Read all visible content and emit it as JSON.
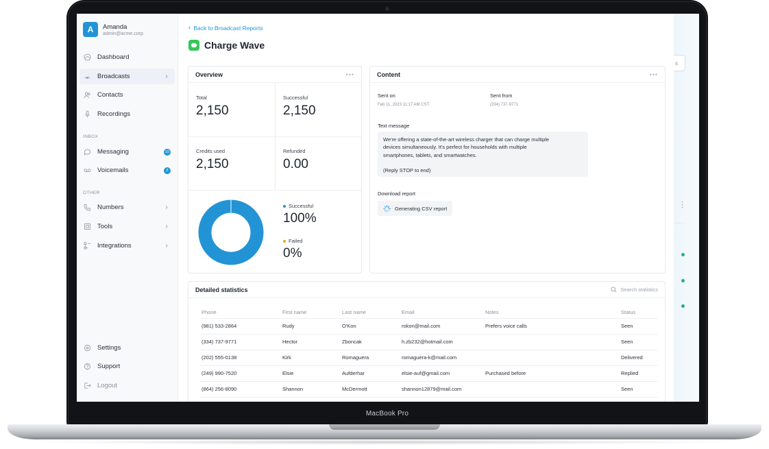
{
  "device": {
    "label": "MacBook Pro"
  },
  "sidebar": {
    "profile": {
      "initial": "A",
      "name": "Amanda",
      "email": "admin@acme.corp"
    },
    "items": [
      {
        "label": "Dashboard",
        "icon": "dashboard-icon"
      },
      {
        "label": "Broadcasts",
        "icon": "broadcast-icon",
        "active": true
      },
      {
        "label": "Contacts",
        "icon": "contacts-icon"
      },
      {
        "label": "Recordings",
        "icon": "microphone-icon"
      }
    ],
    "inbox_title": "INBOX",
    "inbox": [
      {
        "label": "Messaging",
        "icon": "chat-icon",
        "count": "10"
      },
      {
        "label": "Voicemails",
        "icon": "voicemail-icon",
        "count": "2"
      }
    ],
    "other_title": "OTHER",
    "other": [
      {
        "label": "Numbers",
        "icon": "phone-icon"
      },
      {
        "label": "Tools",
        "icon": "tools-icon"
      },
      {
        "label": "Integrations",
        "icon": "integrations-icon"
      }
    ],
    "footer": [
      {
        "label": "Settings",
        "icon": "gear-icon"
      },
      {
        "label": "Support",
        "icon": "help-icon"
      },
      {
        "label": "Logout",
        "icon": "logout-icon"
      }
    ]
  },
  "header": {
    "back_label": "Back to Broadcast Reports",
    "title": "Charge Wave",
    "title_icon_color": "#34c759"
  },
  "overview": {
    "title": "Overview",
    "total_label": "Total",
    "total_value": "2,150",
    "successful_label": "Successful",
    "successful_value": "2,150",
    "credits_label": "Credits used",
    "credits_value": "2,150",
    "refunded_label": "Refunded",
    "refunded_value": "0.00",
    "donut": {
      "successful_label": "Successful",
      "successful_pct": "100%",
      "successful_fraction": 1.0,
      "successful_color": "#2294d6",
      "failed_label": "Failed",
      "failed_pct": "0%",
      "failed_color": "#f0a020"
    }
  },
  "content": {
    "title": "Content",
    "sent_on_label": "Sent on",
    "sent_on_value": "Feb 11, 2023 11:17 AM CST",
    "sent_from_label": "Sent from",
    "sent_from_value": "(334) 737-9771",
    "text_label": "Text message",
    "message_lines": [
      "We're offering a state-of-the-art wireless charger that can charge multiple",
      "devices simultaneously. It's perfect for households with multiple",
      "smartphones, tablets, and smartwatches."
    ],
    "message_footer": "(Reply STOP to end)",
    "download_label": "Download report",
    "csv_label": "Generating CSV report"
  },
  "stats": {
    "title": "Detailed statistics",
    "search_placeholder": "Search statistics",
    "columns": [
      "Phone",
      "First name",
      "Last name",
      "Email",
      "Notes",
      "Status"
    ],
    "rows": [
      [
        "(981) 533-2864",
        "Rudy",
        "O'Kon",
        "rokon@mail.com",
        "Prefers voice calls",
        "Seen"
      ],
      [
        "(334) 737-9771",
        "Hector",
        "Zboncak",
        "h.zb232@hotmail.com",
        "",
        "Seen"
      ],
      [
        "(202) 555-0138",
        "Kirk",
        "Romaguera",
        "romaguera-k@mail.com",
        "",
        "Delivered"
      ],
      [
        "(249) 990-7520",
        "Elsie",
        "Aufderhar",
        "elsie-auf@gmail.com",
        "Purchased before",
        "Replied"
      ],
      [
        "(864) 256-8090",
        "Shannon",
        "McDermott",
        "shannon12879@mail.com",
        "",
        "Seen"
      ]
    ]
  },
  "background_panel": {
    "button_fragment": "s"
  }
}
